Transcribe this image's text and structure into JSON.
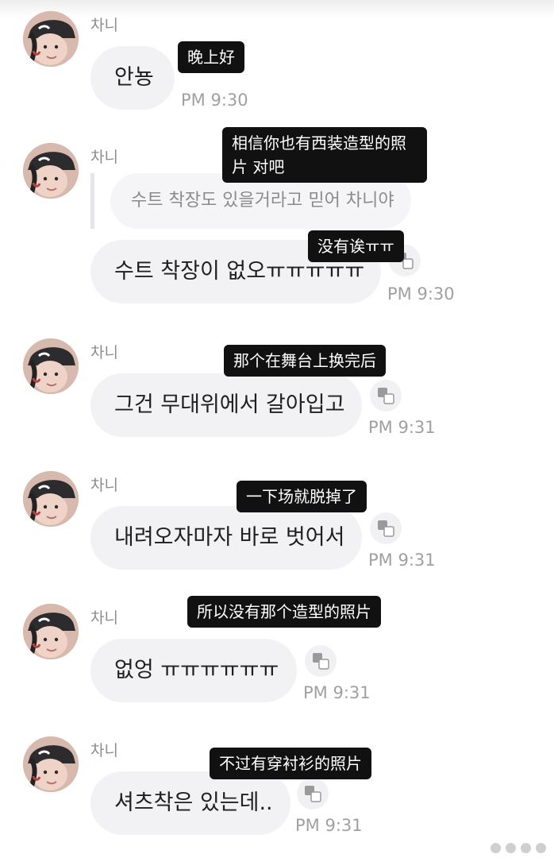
{
  "sender": {
    "name": "차니"
  },
  "messages": [
    {
      "text": "안뇽",
      "caption": "晚上好",
      "time": "PM 9:30",
      "has_translate_icon": false
    },
    {
      "quoted": "수트 착장도 있을거라고 믿어 차니야",
      "text": "수트 착장이 없오ㅠㅠㅠㅠㅠ",
      "caption_top": "相信你也有西装造型的照片 对吧",
      "caption": "没有诶ㅠㅠ",
      "time": "PM 9:30",
      "has_translate_icon": true
    },
    {
      "text": "그건 무대위에서 갈아입고",
      "caption": "那个在舞台上换完后",
      "time": "PM 9:31",
      "has_translate_icon": true
    },
    {
      "text": "내려오자마자 바로 벗어서",
      "caption": "一下场就脱掉了",
      "time": "PM 9:31",
      "has_translate_icon": true
    },
    {
      "text": "없엉 ㅠㅠㅠㅠㅠㅠ",
      "caption": "所以没有那个造型的照片",
      "time": "PM 9:31",
      "has_translate_icon": true
    },
    {
      "text": "셔츠착은 있는데..",
      "caption": "不过有穿衬衫的照片",
      "time": "PM 9:31",
      "has_translate_icon": true
    }
  ],
  "icons": {
    "avatar": "profile-photo",
    "translate": "translate-icon"
  },
  "colors": {
    "bubble": "#f2f2f4",
    "name_text": "#8b8b8b",
    "time_text": "#a0a0a0",
    "caption_bg": "#111111",
    "caption_text": "#ffffff"
  }
}
